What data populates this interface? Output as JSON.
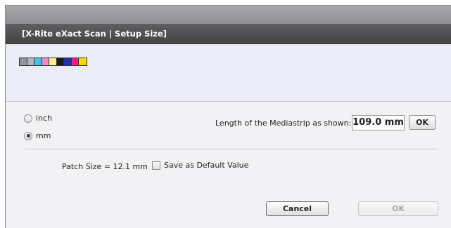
{
  "dialog": {
    "title": "[X-Rite eXact Scan | Setup Size]"
  },
  "mediastrip": {
    "patches": [
      "#8b97a3",
      "#b6b6b8",
      "#44c2e8",
      "#f08ac4",
      "#f7ee8d",
      "#1b1b1b",
      "#2431b3",
      "#e8208c",
      "#ffd500"
    ]
  },
  "units": {
    "inch_label": "inch",
    "mm_label": "mm",
    "selected": "mm"
  },
  "length": {
    "label": "Length of the Mediastrip as shown:",
    "value": "109.0 mm",
    "ok_label": "OK"
  },
  "patch": {
    "size_text": "Patch Size = 12.1 mm"
  },
  "default_checkbox": {
    "label": "Save as Default Value",
    "checked": false
  },
  "buttons": {
    "cancel_label": "Cancel",
    "ok_label": "OK"
  }
}
